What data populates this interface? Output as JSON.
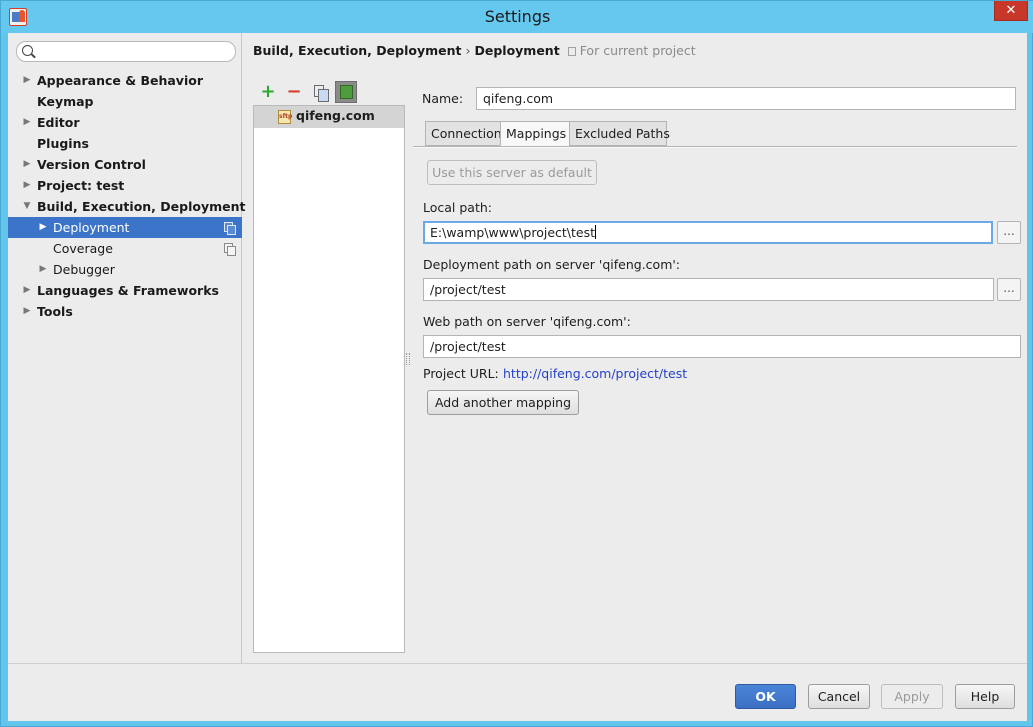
{
  "window": {
    "title": "Settings",
    "close_glyph": "✕"
  },
  "search": {
    "placeholder": ""
  },
  "tree": [
    {
      "label": "Appearance & Behavior",
      "arrow": "▶",
      "level": 0,
      "bold": true
    },
    {
      "label": "Keymap",
      "arrow": "",
      "level": 0,
      "bold": true
    },
    {
      "label": "Editor",
      "arrow": "▶",
      "level": 0,
      "bold": true
    },
    {
      "label": "Plugins",
      "arrow": "",
      "level": 0,
      "bold": true
    },
    {
      "label": "Version Control",
      "arrow": "▶",
      "level": 0,
      "bold": true
    },
    {
      "label": "Project: test",
      "arrow": "▶",
      "level": 0,
      "bold": true
    },
    {
      "label": "Build, Execution, Deployment",
      "arrow": "▼",
      "level": 0,
      "bold": true
    },
    {
      "label": "Deployment",
      "arrow": "▶",
      "level": 1,
      "bold": false,
      "selected": true,
      "copy_icon": true
    },
    {
      "label": "Coverage",
      "arrow": "",
      "level": 1,
      "bold": false,
      "copy_icon": true
    },
    {
      "label": "Debugger",
      "arrow": "▶",
      "level": 1,
      "bold": false
    },
    {
      "label": "Languages & Frameworks",
      "arrow": "▶",
      "level": 0,
      "bold": true
    },
    {
      "label": "Tools",
      "arrow": "▶",
      "level": 0,
      "bold": true
    }
  ],
  "breadcrumb": {
    "first": "Build, Execution, Deployment",
    "sep": "›",
    "second": "Deployment",
    "note": "For current project"
  },
  "toolbar": {
    "add": "+",
    "remove": "−"
  },
  "servers": [
    {
      "name": "qifeng.com",
      "icon": "sftp"
    }
  ],
  "detail": {
    "name_label": "Name:",
    "name_value": "qifeng.com",
    "tabs": [
      "Connection",
      "Mappings",
      "Excluded Paths"
    ],
    "active_tab": "Mappings",
    "use_default_button": "Use this server as default",
    "local_path_label": "Local path:",
    "local_path_value": "E:\\wamp\\www\\project\\test",
    "deploy_path_label": "Deployment path on server 'qifeng.com':",
    "deploy_path_value": "/project/test",
    "web_path_label": "Web path on server 'qifeng.com':",
    "web_path_value": "/project/test",
    "project_url_label": "Project URL:",
    "project_url_value": "http://qifeng.com/project/test",
    "add_mapping_button": "Add another mapping",
    "browse_glyph": "..."
  },
  "footer": {
    "ok": "OK",
    "cancel": "Cancel",
    "apply": "Apply",
    "help": "Help"
  },
  "colors": {
    "accent": "#3b74c8",
    "link": "#2542c8",
    "window_frame": "#62c6ec"
  }
}
